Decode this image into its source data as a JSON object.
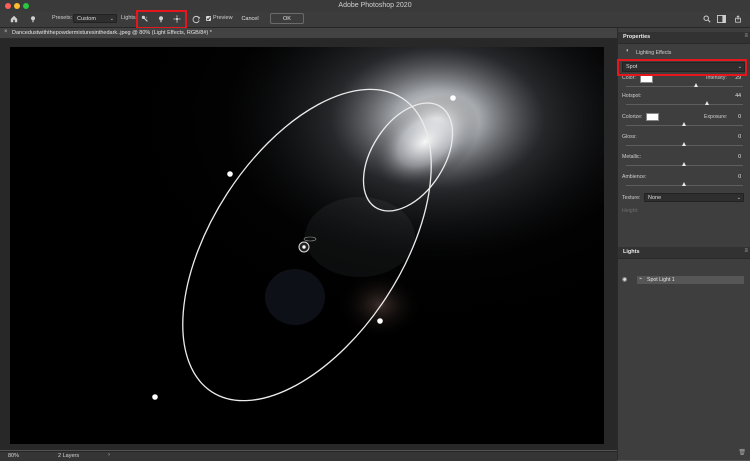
{
  "window": {
    "title": "Adobe Photoshop 2020"
  },
  "options_bar": {
    "presets_label": "Presets:",
    "presets_value": "Custom",
    "lights_label": "Lights:",
    "preview_label": "Preview",
    "preview_checked": true,
    "cancel_label": "Cancel",
    "ok_label": "OK"
  },
  "document": {
    "tab_label": "Dancedustwiththepowdermixturesinthedark..jpeg @ 80% (Light Effects, RGB/8#) *"
  },
  "status_bar": {
    "zoom": "80%",
    "layers": "2 Layers"
  },
  "properties": {
    "header": "Properties",
    "subheader": "Lighting Effects",
    "light_type": "Spot",
    "color_label": "Color:",
    "intensity_label": "Intensity:",
    "intensity_value": "29",
    "hotspot_label": "Hotspot:",
    "hotspot_value": "44",
    "colorize_label": "Colorize:",
    "exposure_label": "Exposure:",
    "exposure_value": "0",
    "gloss_label": "Gloss:",
    "gloss_value": "0",
    "metallic_label": "Metallic:",
    "metallic_value": "0",
    "ambience_label": "Ambience:",
    "ambience_value": "0",
    "texture_label": "Texture:",
    "texture_value": "None",
    "height_label": "Height:",
    "sliders": {
      "intensity": 0.6,
      "hotspot": 0.7,
      "exposure": 0.5,
      "gloss": 0.5,
      "metallic": 0.5,
      "ambience": 0.5
    }
  },
  "lights_panel": {
    "header": "Lights",
    "items": [
      {
        "label": "Spot Light 1"
      }
    ]
  },
  "colors": {
    "highlight": "#e3171c"
  }
}
